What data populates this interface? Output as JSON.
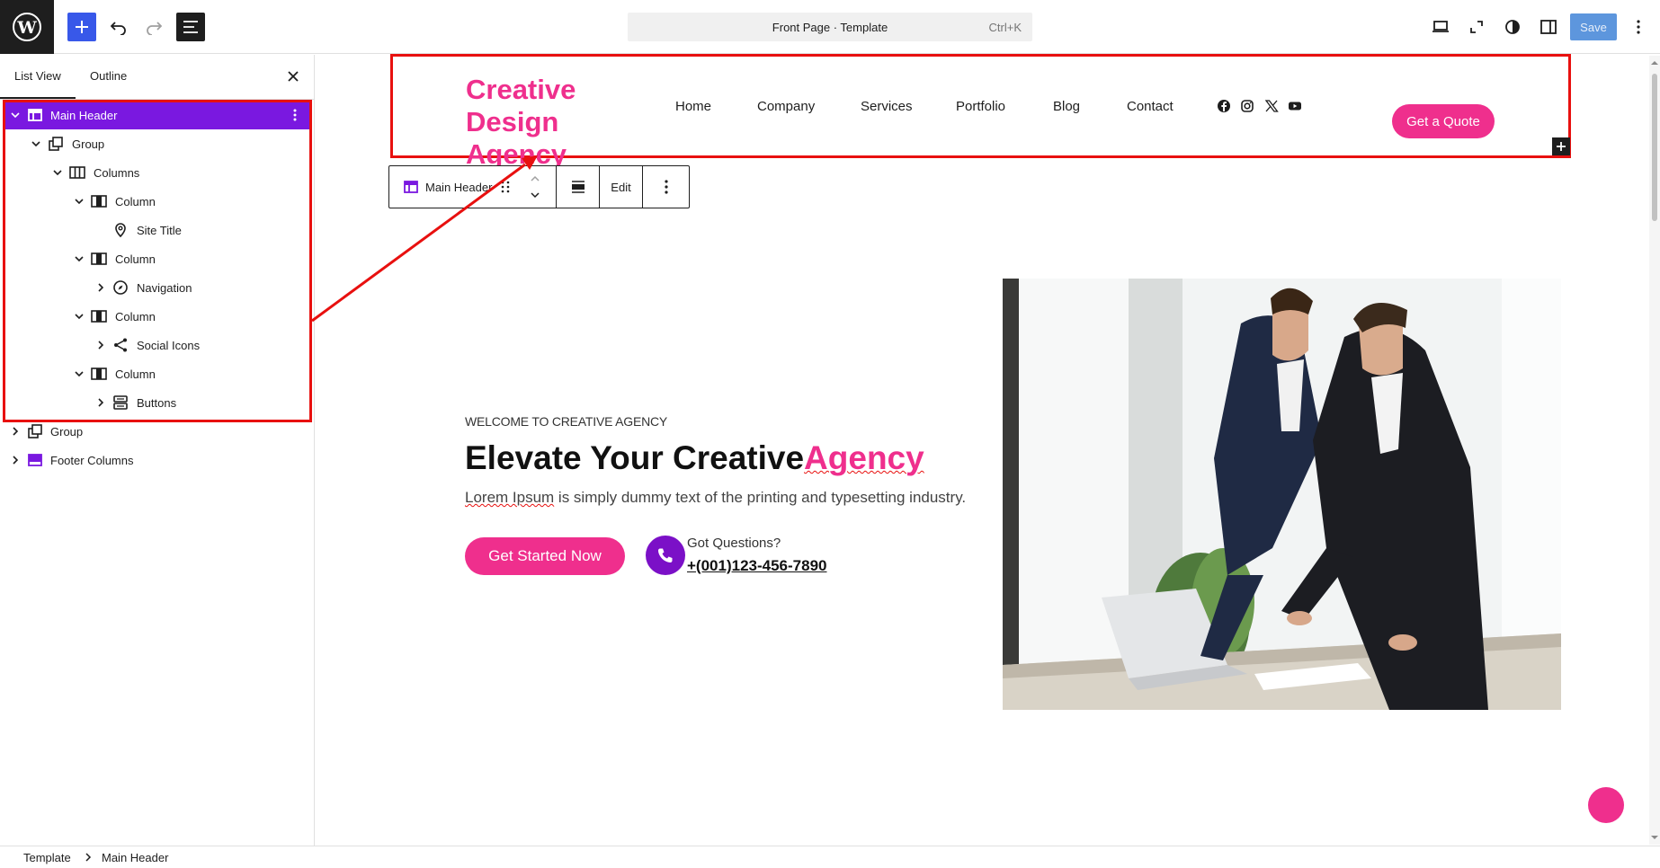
{
  "topbar": {
    "cmd_title": "Front Page · Template",
    "cmd_shortcut": "Ctrl+K",
    "save_label": "Save",
    "icons": [
      "wordpress-icon",
      "plus-icon",
      "undo-icon",
      "redo-icon",
      "list-view-icon",
      "desktop-icon",
      "fullscreen-icon",
      "contrast-icon",
      "sidebar-icon",
      "more-vertical-icon"
    ]
  },
  "sidebar": {
    "tabs": [
      {
        "label": "List View"
      },
      {
        "label": "Outline"
      }
    ],
    "tree": [
      {
        "label": "Main Header",
        "icon": "template-part-icon",
        "selected": true
      },
      {
        "label": "Group",
        "icon": "group-icon"
      },
      {
        "label": "Columns",
        "icon": "columns-icon"
      },
      {
        "label": "Column",
        "icon": "column-icon"
      },
      {
        "label": "Site Title",
        "icon": "map-pin-icon"
      },
      {
        "label": "Column",
        "icon": "column-icon"
      },
      {
        "label": "Navigation",
        "icon": "compass-icon"
      },
      {
        "label": "Column",
        "icon": "column-icon"
      },
      {
        "label": "Social Icons",
        "icon": "share-icon"
      },
      {
        "label": "Column",
        "icon": "column-icon"
      },
      {
        "label": "Buttons",
        "icon": "buttons-icon"
      },
      {
        "label": "Group",
        "icon": "group-icon"
      },
      {
        "label": "Footer Columns",
        "icon": "template-part-icon"
      }
    ]
  },
  "breadcrumb": {
    "items": [
      "Template",
      "Main Header"
    ]
  },
  "canvas": {
    "header": {
      "site_title": "Creative Design Agency",
      "nav": [
        "Home",
        "Company",
        "Services",
        "Portfolio",
        "Blog",
        "Contact"
      ],
      "social": [
        "facebook-icon",
        "instagram-icon",
        "x-icon",
        "youtube-icon"
      ],
      "cta": "Get a Quote"
    },
    "block_toolbar": {
      "parent_label": "Main Header",
      "edit_label": "Edit"
    },
    "hero": {
      "eyebrow": "WELCOME TO CREATIVE AGENCY",
      "heading_main": "Elevate Your Creative",
      "heading_accent": "Agency",
      "text_lead": "Lorem Ipsum",
      "text_rest": " is simply dummy text of the printing and typesetting industry.",
      "cta": "Get Started Now",
      "phone_label": "Got Questions?",
      "phone_number": "+(001)123-456-7890"
    }
  },
  "colors": {
    "accent": "#ef2f8d",
    "purple": "#7a18e0",
    "wp_blue": "#3858e9",
    "annotation_red": "#e8100f"
  }
}
